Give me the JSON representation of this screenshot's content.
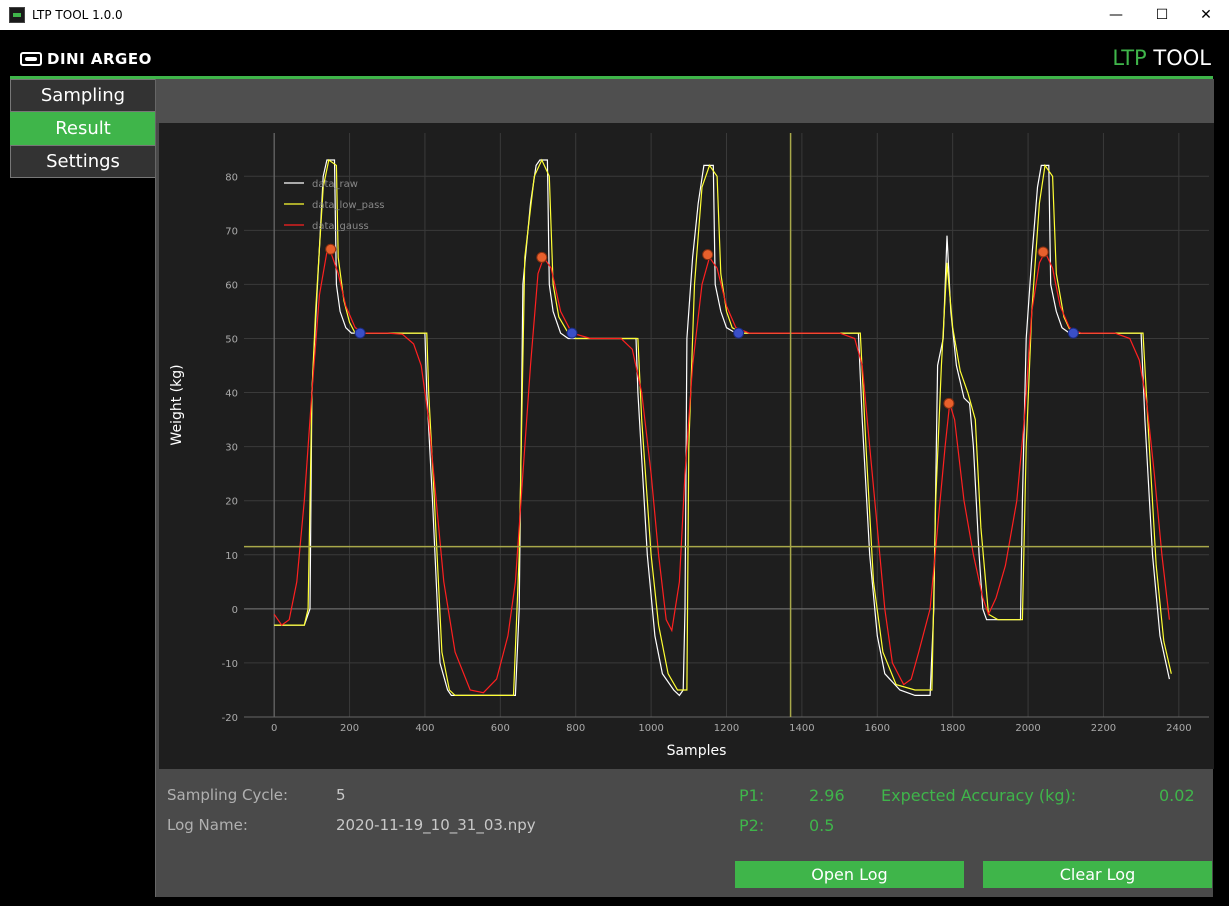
{
  "window": {
    "title": "LTP TOOL 1.0.0",
    "minimize": "—",
    "maximize": "☐",
    "close": "✕"
  },
  "header": {
    "brand": "DINI ARGEO",
    "product_prefix": "LTP",
    "product_suffix": " TOOL"
  },
  "colors": {
    "accent": "#3fb54a",
    "raw": "#ffffff",
    "low_pass": "#ffff33",
    "gauss": "#ff2020",
    "peak_marker": "#e8602c",
    "settle_marker": "#3a4fc8"
  },
  "sidebar": {
    "items": [
      {
        "label": "Sampling"
      },
      {
        "label": "Result"
      },
      {
        "label": "Settings"
      }
    ],
    "active": "Result"
  },
  "info": {
    "sampling_cycle_label": "Sampling Cycle:",
    "sampling_cycle_value": "5",
    "log_name_label": "Log Name:",
    "log_name_value": "2020-11-19_10_31_03.npy",
    "p1_label": "P1:",
    "p1_value": "2.96",
    "p2_label": "P2:",
    "p2_value": "0.5",
    "accuracy_label": "Expected Accuracy (kg):",
    "accuracy_value": "0.02"
  },
  "buttons": {
    "open_log": "Open Log",
    "clear_log": "Clear Log"
  },
  "chart_data": {
    "type": "line",
    "xlabel": "Samples",
    "ylabel": "Weight (kg)",
    "xlim": [
      -80,
      2480
    ],
    "ylim": [
      -20,
      88
    ],
    "xticks": [
      0,
      200,
      400,
      600,
      800,
      1000,
      1200,
      1400,
      1600,
      1800,
      2000,
      2200,
      2400
    ],
    "yticks": [
      -20,
      -10,
      0,
      10,
      20,
      30,
      40,
      50,
      60,
      70,
      80
    ],
    "grid": true,
    "legend_position": "top-left",
    "threshold_y": 11.5,
    "cursor_x": 1370,
    "series": [
      {
        "name": "data_raw",
        "color": "#ffffff",
        "points": [
          [
            0,
            -3
          ],
          [
            80,
            -3
          ],
          [
            95,
            0
          ],
          [
            100,
            40
          ],
          [
            115,
            60
          ],
          [
            130,
            80
          ],
          [
            140,
            83
          ],
          [
            160,
            83
          ],
          [
            165,
            60
          ],
          [
            175,
            55
          ],
          [
            190,
            52
          ],
          [
            205,
            51
          ],
          [
            400,
            51
          ],
          [
            405,
            40
          ],
          [
            420,
            20
          ],
          [
            440,
            -10
          ],
          [
            460,
            -15
          ],
          [
            470,
            -16
          ],
          [
            640,
            -16
          ],
          [
            650,
            0
          ],
          [
            660,
            60
          ],
          [
            680,
            75
          ],
          [
            695,
            82
          ],
          [
            705,
            83
          ],
          [
            725,
            83
          ],
          [
            730,
            60
          ],
          [
            740,
            55
          ],
          [
            760,
            51
          ],
          [
            780,
            50
          ],
          [
            960,
            50
          ],
          [
            965,
            40
          ],
          [
            990,
            10
          ],
          [
            1010,
            -5
          ],
          [
            1030,
            -12
          ],
          [
            1060,
            -15
          ],
          [
            1075,
            -16
          ],
          [
            1085,
            -15
          ],
          [
            1090,
            0
          ],
          [
            1095,
            50
          ],
          [
            1110,
            65
          ],
          [
            1125,
            75
          ],
          [
            1140,
            82
          ],
          [
            1165,
            82
          ],
          [
            1170,
            60
          ],
          [
            1185,
            55
          ],
          [
            1200,
            52
          ],
          [
            1225,
            51
          ],
          [
            1550,
            51
          ],
          [
            1560,
            35
          ],
          [
            1580,
            10
          ],
          [
            1600,
            -5
          ],
          [
            1620,
            -12
          ],
          [
            1660,
            -15
          ],
          [
            1700,
            -16
          ],
          [
            1740,
            -16
          ],
          [
            1750,
            0
          ],
          [
            1760,
            45
          ],
          [
            1775,
            50
          ],
          [
            1785,
            69
          ],
          [
            1795,
            55
          ],
          [
            1810,
            45
          ],
          [
            1830,
            39
          ],
          [
            1845,
            38
          ],
          [
            1855,
            30
          ],
          [
            1870,
            10
          ],
          [
            1880,
            0
          ],
          [
            1890,
            -2
          ],
          [
            1910,
            -2
          ],
          [
            1980,
            -2
          ],
          [
            1985,
            20
          ],
          [
            1995,
            50
          ],
          [
            2010,
            65
          ],
          [
            2025,
            78
          ],
          [
            2035,
            82
          ],
          [
            2055,
            82
          ],
          [
            2060,
            60
          ],
          [
            2075,
            55
          ],
          [
            2090,
            52
          ],
          [
            2110,
            51
          ],
          [
            2300,
            51
          ],
          [
            2310,
            35
          ],
          [
            2330,
            10
          ],
          [
            2350,
            -5
          ],
          [
            2375,
            -13
          ]
        ]
      },
      {
        "name": "data_low_pass",
        "color": "#ffff33",
        "points": [
          [
            0,
            -3
          ],
          [
            80,
            -3
          ],
          [
            90,
            0
          ],
          [
            100,
            40
          ],
          [
            110,
            55
          ],
          [
            130,
            78
          ],
          [
            145,
            83
          ],
          [
            165,
            82
          ],
          [
            170,
            65
          ],
          [
            185,
            57
          ],
          [
            200,
            53
          ],
          [
            215,
            51
          ],
          [
            405,
            51
          ],
          [
            410,
            40
          ],
          [
            425,
            20
          ],
          [
            445,
            -8
          ],
          [
            465,
            -15
          ],
          [
            480,
            -16
          ],
          [
            635,
            -16
          ],
          [
            650,
            10
          ],
          [
            665,
            65
          ],
          [
            690,
            80
          ],
          [
            710,
            83
          ],
          [
            730,
            80
          ],
          [
            740,
            60
          ],
          [
            755,
            54
          ],
          [
            780,
            51
          ],
          [
            800,
            50
          ],
          [
            965,
            50
          ],
          [
            975,
            35
          ],
          [
            1000,
            10
          ],
          [
            1020,
            -3
          ],
          [
            1045,
            -12
          ],
          [
            1070,
            -15
          ],
          [
            1095,
            -15
          ],
          [
            1100,
            30
          ],
          [
            1115,
            60
          ],
          [
            1135,
            78
          ],
          [
            1155,
            82
          ],
          [
            1175,
            80
          ],
          [
            1185,
            62
          ],
          [
            1200,
            55
          ],
          [
            1215,
            52
          ],
          [
            1240,
            51
          ],
          [
            1555,
            51
          ],
          [
            1570,
            30
          ],
          [
            1590,
            5
          ],
          [
            1615,
            -8
          ],
          [
            1650,
            -14
          ],
          [
            1700,
            -15
          ],
          [
            1745,
            -15
          ],
          [
            1755,
            20
          ],
          [
            1770,
            45
          ],
          [
            1785,
            64
          ],
          [
            1800,
            52
          ],
          [
            1820,
            44
          ],
          [
            1840,
            40
          ],
          [
            1860,
            35
          ],
          [
            1875,
            15
          ],
          [
            1895,
            -1
          ],
          [
            1920,
            -2
          ],
          [
            1985,
            -2
          ],
          [
            1995,
            30
          ],
          [
            2010,
            55
          ],
          [
            2030,
            75
          ],
          [
            2045,
            82
          ],
          [
            2065,
            80
          ],
          [
            2075,
            62
          ],
          [
            2095,
            54
          ],
          [
            2115,
            51
          ],
          [
            2305,
            51
          ],
          [
            2320,
            32
          ],
          [
            2340,
            8
          ],
          [
            2360,
            -6
          ],
          [
            2380,
            -12
          ]
        ]
      },
      {
        "name": "data_gauss",
        "color": "#ff2020",
        "points": [
          [
            0,
            -1
          ],
          [
            20,
            -3
          ],
          [
            40,
            -2
          ],
          [
            60,
            5
          ],
          [
            80,
            20
          ],
          [
            100,
            40
          ],
          [
            120,
            58
          ],
          [
            140,
            66
          ],
          [
            150,
            66
          ],
          [
            170,
            62
          ],
          [
            190,
            56
          ],
          [
            215,
            52
          ],
          [
            240,
            51
          ],
          [
            300,
            51
          ],
          [
            340,
            50.8
          ],
          [
            370,
            49
          ],
          [
            390,
            45
          ],
          [
            410,
            35
          ],
          [
            430,
            20
          ],
          [
            450,
            5
          ],
          [
            480,
            -8
          ],
          [
            520,
            -15
          ],
          [
            555,
            -15.5
          ],
          [
            590,
            -13
          ],
          [
            620,
            -5
          ],
          [
            640,
            5
          ],
          [
            660,
            25
          ],
          [
            680,
            45
          ],
          [
            700,
            62
          ],
          [
            715,
            65
          ],
          [
            735,
            63
          ],
          [
            760,
            55
          ],
          [
            790,
            51
          ],
          [
            840,
            50
          ],
          [
            920,
            50
          ],
          [
            950,
            48
          ],
          [
            975,
            40
          ],
          [
            1000,
            25
          ],
          [
            1020,
            10
          ],
          [
            1040,
            -2
          ],
          [
            1055,
            -4
          ],
          [
            1075,
            5
          ],
          [
            1090,
            25
          ],
          [
            1110,
            45
          ],
          [
            1135,
            60
          ],
          [
            1155,
            65
          ],
          [
            1175,
            63
          ],
          [
            1200,
            56
          ],
          [
            1225,
            52
          ],
          [
            1260,
            51
          ],
          [
            1500,
            51
          ],
          [
            1540,
            50
          ],
          [
            1560,
            45
          ],
          [
            1580,
            30
          ],
          [
            1600,
            15
          ],
          [
            1620,
            0
          ],
          [
            1640,
            -10
          ],
          [
            1670,
            -14
          ],
          [
            1690,
            -13
          ],
          [
            1710,
            -8
          ],
          [
            1740,
            0
          ],
          [
            1760,
            15
          ],
          [
            1780,
            30
          ],
          [
            1792,
            38
          ],
          [
            1805,
            35
          ],
          [
            1830,
            20
          ],
          [
            1855,
            10
          ],
          [
            1880,
            2
          ],
          [
            1895,
            -1
          ],
          [
            1915,
            2
          ],
          [
            1940,
            8
          ],
          [
            1970,
            20
          ],
          [
            1990,
            35
          ],
          [
            2010,
            55
          ],
          [
            2030,
            64
          ],
          [
            2045,
            66
          ],
          [
            2065,
            63
          ],
          [
            2085,
            56
          ],
          [
            2110,
            52
          ],
          [
            2140,
            51
          ],
          [
            2230,
            51
          ],
          [
            2270,
            50
          ],
          [
            2295,
            46
          ],
          [
            2315,
            38
          ],
          [
            2335,
            25
          ],
          [
            2355,
            10
          ],
          [
            2375,
            -2
          ]
        ]
      }
    ],
    "peak_markers": [
      [
        150,
        66.5
      ],
      [
        710,
        65
      ],
      [
        1150,
        65.5
      ],
      [
        1790,
        38
      ],
      [
        2040,
        66
      ]
    ],
    "settle_markers": [
      [
        228,
        51
      ],
      [
        790,
        51
      ],
      [
        1232,
        51
      ],
      [
        2120,
        51
      ]
    ]
  }
}
